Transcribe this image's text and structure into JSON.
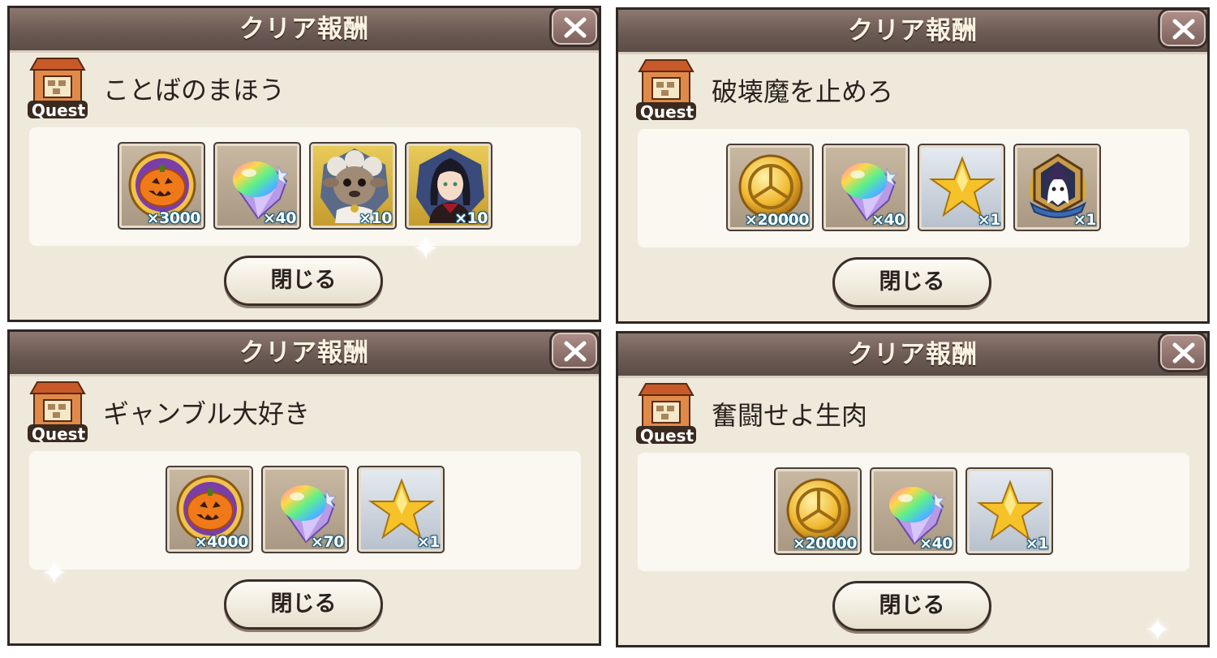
{
  "panels": [
    {
      "title": "クリア報酬",
      "quest_badge": "Quest",
      "quest_name": "ことばのまほう",
      "close_label": "閉じる",
      "rewards": [
        {
          "icon": "pumpkin-medal-icon",
          "qty": "×3000"
        },
        {
          "icon": "rainbow-crystal-icon",
          "qty": "×40"
        },
        {
          "icon": "sheep-character-icon",
          "qty": "×10"
        },
        {
          "icon": "dark-haired-girl-character-icon",
          "qty": "×10"
        }
      ]
    },
    {
      "title": "クリア報酬",
      "quest_badge": "Quest",
      "quest_name": "破壊魔を止めろ",
      "close_label": "閉じる",
      "rewards": [
        {
          "icon": "gold-coin-icon",
          "qty": "×20000"
        },
        {
          "icon": "rainbow-crystal-icon",
          "qty": "×40"
        },
        {
          "icon": "gold-star-icon",
          "qty": "×1"
        },
        {
          "icon": "ghost-emblem-icon",
          "qty": "×1"
        }
      ]
    },
    {
      "title": "クリア報酬",
      "quest_badge": "Quest",
      "quest_name": "ギャンブル大好き",
      "close_label": "閉じる",
      "rewards": [
        {
          "icon": "pumpkin-medal-icon",
          "qty": "×4000"
        },
        {
          "icon": "rainbow-crystal-icon",
          "qty": "×70"
        },
        {
          "icon": "gold-star-icon",
          "qty": "×1"
        }
      ]
    },
    {
      "title": "クリア報酬",
      "quest_badge": "Quest",
      "quest_name": "奮闘せよ生肉",
      "close_label": "閉じる",
      "rewards": [
        {
          "icon": "gold-coin-icon",
          "qty": "×20000"
        },
        {
          "icon": "rainbow-crystal-icon",
          "qty": "×40"
        },
        {
          "icon": "gold-star-icon",
          "qty": "×1"
        }
      ]
    }
  ]
}
